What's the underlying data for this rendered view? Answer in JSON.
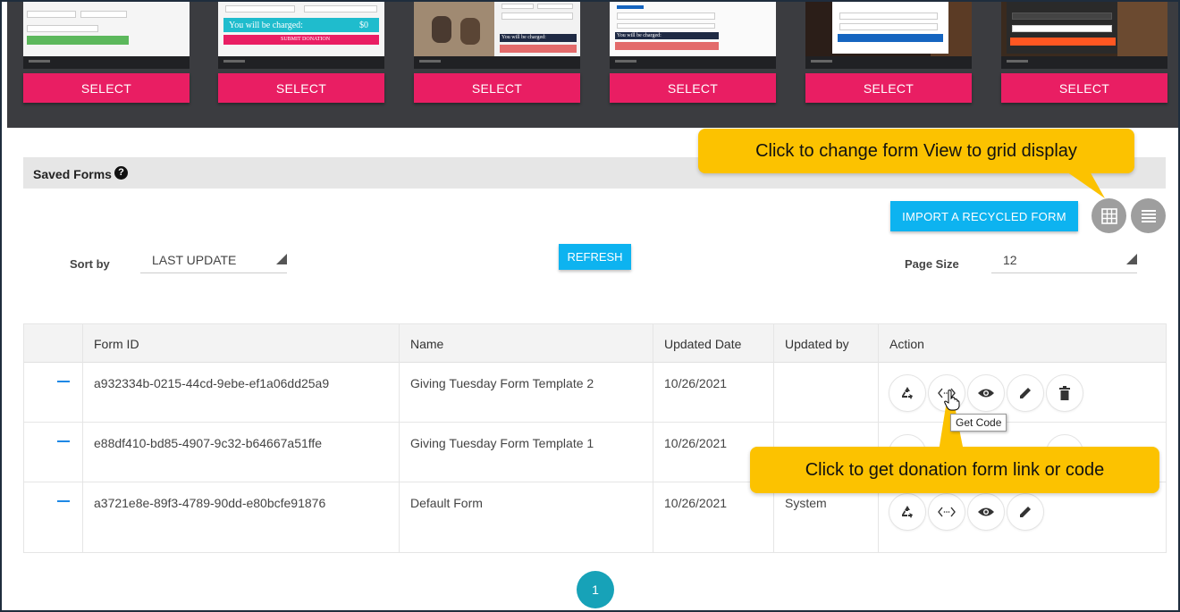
{
  "templates": {
    "select_label": "SELECT",
    "thumb_texts": {
      "charged": "You will be charged:",
      "amount": "$0",
      "submit": "SUBMIT DONATION"
    }
  },
  "saved_forms": {
    "title": "Saved Forms",
    "help_icon": "?",
    "import_label": "IMPORT A RECYCLED FORM",
    "grid_view_icon": "grid-icon",
    "list_view_icon": "list-icon",
    "sort_label": "Sort by",
    "sort_value": "LAST UPDATE",
    "refresh_label": "REFRESH",
    "page_size_label": "Page Size",
    "page_size_value": "12"
  },
  "table": {
    "columns": [
      "Form ID",
      "Name",
      "Updated Date",
      "Updated by",
      "Action"
    ],
    "rows": [
      {
        "id": "a932334b-0215-44cd-9ebe-ef1a06dd25a9",
        "name": "Giving Tuesday Form Template 2",
        "date": "10/26/2021",
        "by": ""
      },
      {
        "id": "e88df410-bd85-4907-9c32-b64667a51ffe",
        "name": "Giving Tuesday Form Template 1",
        "date": "10/26/2021",
        "by": ""
      },
      {
        "id": "a3721e8e-89f3-4789-90dd-e80bcfe91876",
        "name": "Default Form",
        "date": "10/26/2021",
        "by": "System"
      }
    ],
    "action_icons": [
      "recycle-icon",
      "code-icon",
      "eye-icon",
      "pencil-icon",
      "trash-icon"
    ]
  },
  "pagination": {
    "current_page": "1"
  },
  "callouts": {
    "grid_tip": "Click to change form View to grid display",
    "code_tip": "Click to get donation form link or code"
  },
  "tooltip": {
    "text": "Get Code"
  },
  "colors": {
    "select": "#e91e63",
    "primary": "#0db3f0",
    "callout": "#fcc200",
    "pager": "#17a2b8"
  }
}
